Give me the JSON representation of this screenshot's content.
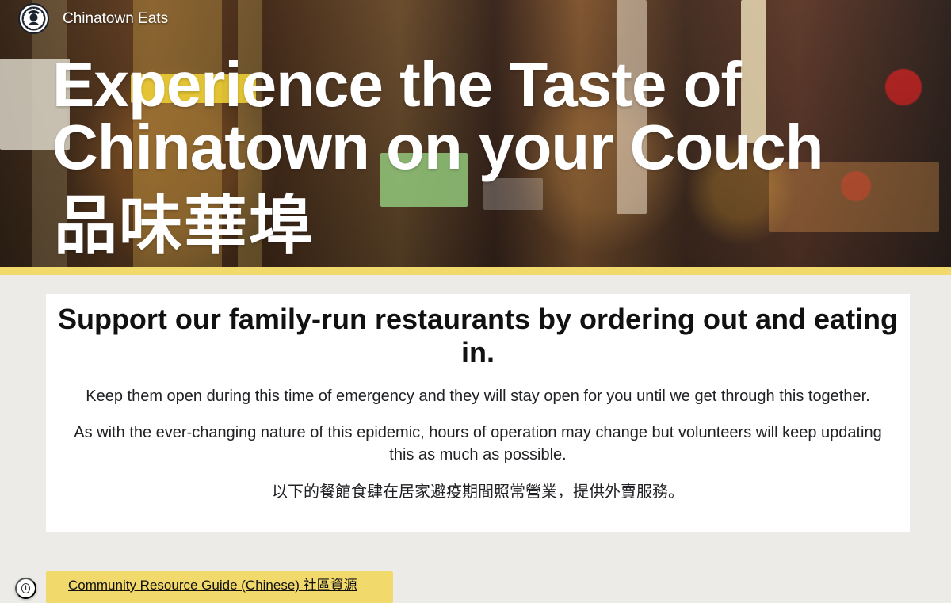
{
  "site": {
    "title": "Chinatown Eats",
    "logo_icon": "chinatown-eats-logo-icon"
  },
  "hero": {
    "title": "Experience the Taste of Chinatown on your Couch",
    "chinese_title": "品味華埠"
  },
  "intro": {
    "heading": "Support our family-run restaurants by ordering out and eating in.",
    "paragraphs": [
      "Keep them open during this time of emergency and they will stay open for you until we get through this together.",
      "As with the ever-changing nature of this epidemic, hours of operation may change but volunteers will keep updating this as much as possible.",
      "以下的餐館食肆在居家避疫期間照常營業，提供外賣服務。"
    ]
  },
  "actions": {
    "community_resource_label": "Community Resource Guide (Chinese) 社區資源",
    "info_icon": "info-icon"
  },
  "colors": {
    "accent_yellow": "#f2d96c",
    "page_background": "#ecebe8",
    "card_background": "#ffffff",
    "heading_text": "#111111",
    "body_text": "#202124"
  }
}
